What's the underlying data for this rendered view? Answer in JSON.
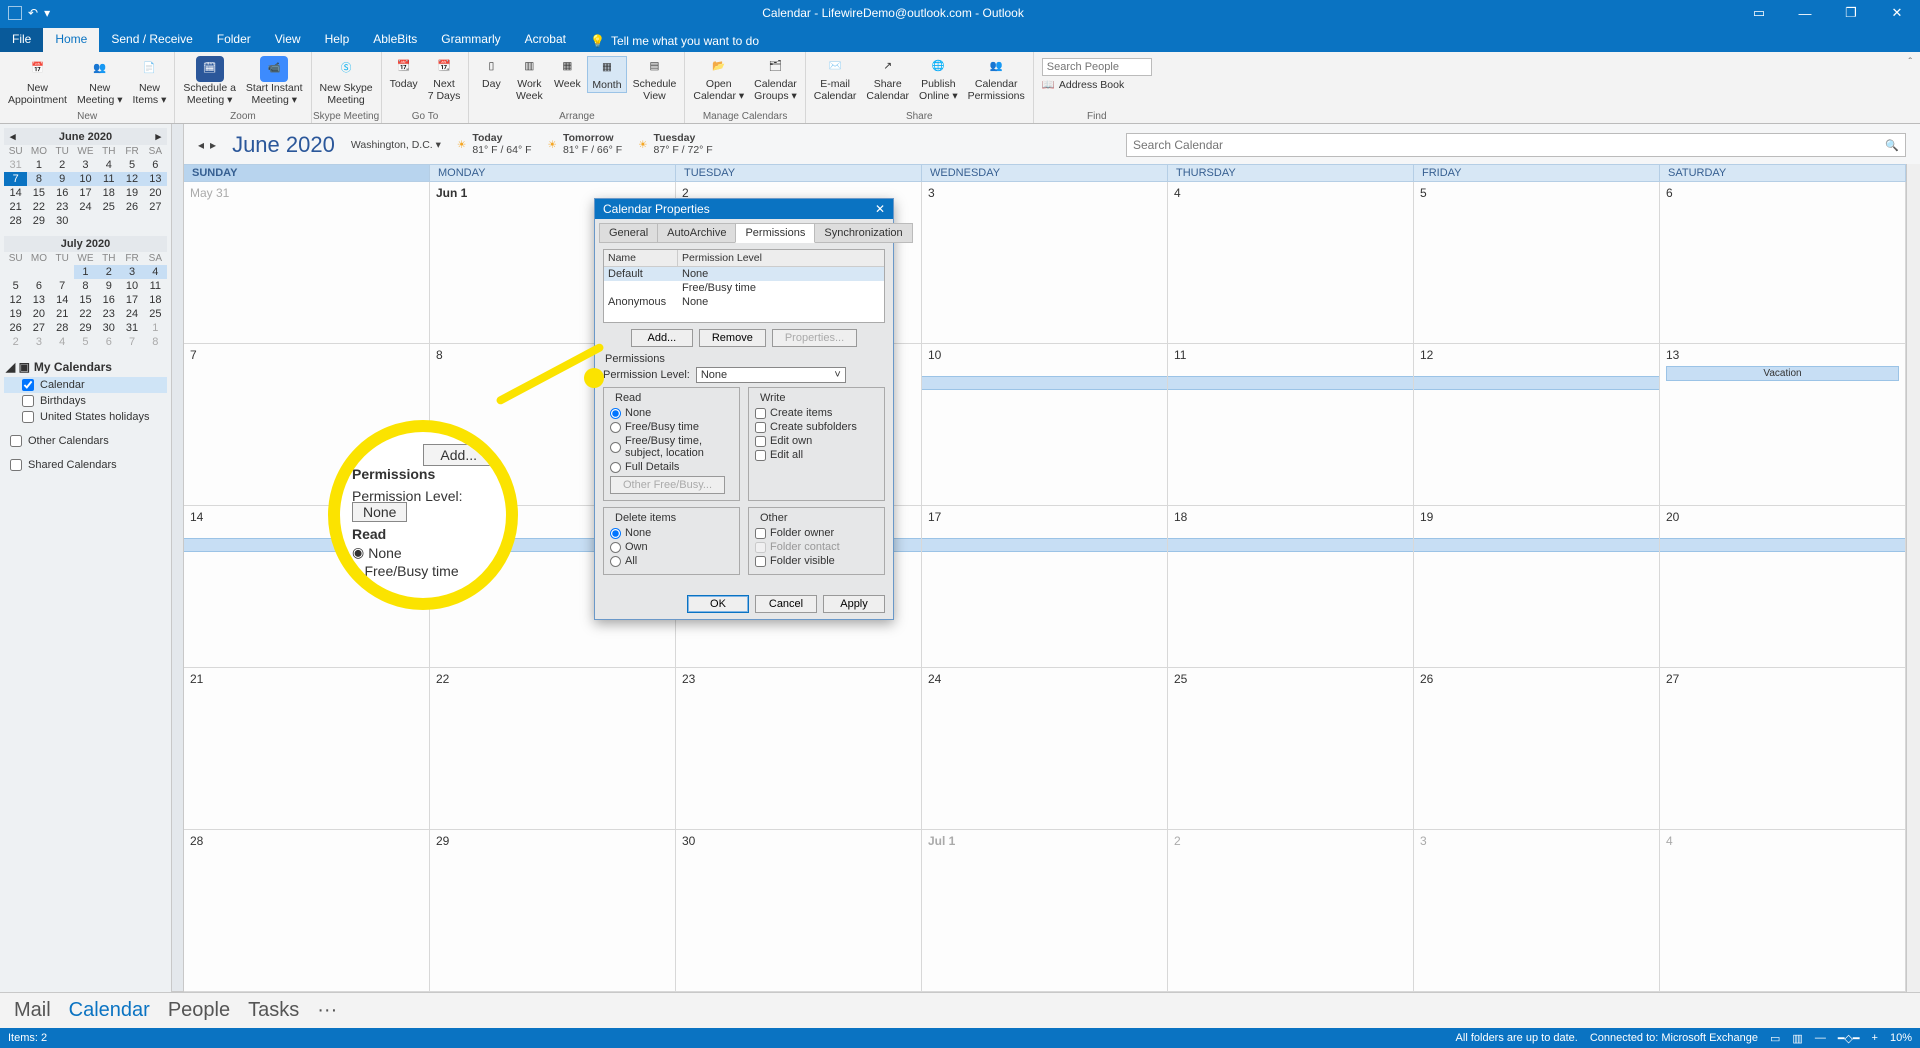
{
  "titlebar": {
    "title": "Calendar - LifewireDemo@outlook.com - Outlook"
  },
  "menu": {
    "file": "File",
    "home": "Home",
    "sendrecv": "Send / Receive",
    "folder": "Folder",
    "view": "View",
    "help": "Help",
    "ablebits": "AbleBits",
    "grammarly": "Grammarly",
    "acrobat": "Acrobat",
    "tellme": "Tell me what you want to do"
  },
  "ribbon": {
    "newapp": "New\nAppointment",
    "newmeet": "New\nMeeting ▾",
    "newitems": "New\nItems ▾",
    "schedmeet": "Schedule a\nMeeting ▾",
    "startinst": "Start Instant\nMeeting ▾",
    "skype": "New Skype\nMeeting",
    "today": "Today",
    "next7": "Next\n7 Days",
    "day": "Day",
    "wweek": "Work\nWeek",
    "week": "Week",
    "month": "Month",
    "schedview": "Schedule\nView",
    "opencal": "Open\nCalendar ▾",
    "calgroups": "Calendar\nGroups ▾",
    "emailcal": "E-mail\nCalendar",
    "sharecal": "Share\nCalendar",
    "pubonline": "Publish\nOnline ▾",
    "calperm": "Calendar\nPermissions",
    "searchppl": "Search People",
    "addrbook": "Address Book",
    "g_new": "New",
    "g_zoom": "Zoom",
    "g_skype": "Skype Meeting",
    "g_goto": "Go To",
    "g_arrange": "Arrange",
    "g_manage": "Manage Calendars",
    "g_share": "Share",
    "g_find": "Find"
  },
  "side": {
    "month1": "June 2020",
    "month2": "July 2020",
    "dow": [
      "SU",
      "MO",
      "TU",
      "WE",
      "TH",
      "FR",
      "SA"
    ],
    "m1": [
      [
        "31",
        "1",
        "2",
        "3",
        "4",
        "5",
        "6"
      ],
      [
        "7",
        "8",
        "9",
        "10",
        "11",
        "12",
        "13"
      ],
      [
        "14",
        "15",
        "16",
        "17",
        "18",
        "19",
        "20"
      ],
      [
        "21",
        "22",
        "23",
        "24",
        "25",
        "26",
        "27"
      ],
      [
        "28",
        "29",
        "30",
        "",
        "",
        "",
        ""
      ]
    ],
    "m2": [
      [
        "",
        "",
        "",
        "1",
        "2",
        "3",
        "4"
      ],
      [
        "5",
        "6",
        "7",
        "8",
        "9",
        "10",
        "11"
      ],
      [
        "12",
        "13",
        "14",
        "15",
        "16",
        "17",
        "18"
      ],
      [
        "19",
        "20",
        "21",
        "22",
        "23",
        "24",
        "25"
      ],
      [
        "26",
        "27",
        "28",
        "29",
        "30",
        "31",
        "1"
      ],
      [
        "2",
        "3",
        "4",
        "5",
        "6",
        "7",
        "8"
      ]
    ],
    "mycal": "My Calendars",
    "calendar": "Calendar",
    "bday": "Birthdays",
    "ushol": "United States holidays",
    "other": "Other Calendars",
    "shared": "Shared Calendars"
  },
  "cal": {
    "title": "June 2020",
    "loc": "Washington, D.C.  ▾",
    "w1": "Today",
    "w1t": "81° F / 64° F",
    "w2": "Tomorrow",
    "w2t": "81° F / 66° F",
    "w3": "Tuesday",
    "w3t": "87° F / 72° F",
    "search": "Search Calendar",
    "days": [
      "SUNDAY",
      "MONDAY",
      "TUESDAY",
      "WEDNESDAY",
      "THURSDAY",
      "FRIDAY",
      "SATURDAY"
    ],
    "r1": [
      "May 31",
      "Jun 1",
      "2",
      "3",
      "4",
      "5",
      "6"
    ],
    "r2": [
      "7",
      "8",
      "9",
      "10",
      "11",
      "12",
      "13"
    ],
    "r3": [
      "14",
      "15",
      "16",
      "17",
      "18",
      "19",
      "20"
    ],
    "r4": [
      "21",
      "22",
      "23",
      "24",
      "25",
      "26",
      "27"
    ],
    "r5": [
      "28",
      "29",
      "30",
      "Jul 1",
      "2",
      "3",
      "4"
    ],
    "vacation": "Vacation"
  },
  "dialog": {
    "title": "Calendar Properties",
    "tabs": {
      "gen": "General",
      "auto": "AutoArchive",
      "perm": "Permissions",
      "sync": "Synchronization"
    },
    "col_name": "Name",
    "col_pl": "Permission Level",
    "rows": [
      {
        "n": "Default",
        "p": "None"
      },
      {
        "n": "",
        "p": "Free/Busy time"
      },
      {
        "n": "Anonymous",
        "p": "None"
      }
    ],
    "add": "Add...",
    "remove": "Remove",
    "props": "Properties...",
    "permissions": "Permissions",
    "permlevel": "Permission Level:",
    "pl_val": "None",
    "read": "Read",
    "write": "Write",
    "r_none": "None",
    "r_fb": "Free/Busy time",
    "r_fbs": "Free/Busy time, subject, location",
    "r_full": "Full Details",
    "r_other": "Other Free/Busy...",
    "w_ci": "Create items",
    "w_cs": "Create subfolders",
    "w_eo": "Edit own",
    "w_ea": "Edit all",
    "del": "Delete items",
    "d_none": "None",
    "d_own": "Own",
    "d_all": "All",
    "other": "Other",
    "o_fo": "Folder owner",
    "o_fc": "Folder contact",
    "o_fv": "Folder visible",
    "ok": "OK",
    "cancel": "Cancel",
    "apply": "Apply"
  },
  "zoom": {
    "add": "Add...",
    "perm": "Permissions",
    "pl": "Permission Level:",
    "none": "None",
    "read": "Read",
    "r_none": "None",
    "r_fb": "Free/Busy time"
  },
  "nav": {
    "mail": "Mail",
    "cal": "Calendar",
    "ppl": "People",
    "tasks": "Tasks"
  },
  "status": {
    "items": "Items: 2",
    "upd": "All folders are up to date.",
    "conn": "Connected to: Microsoft Exchange",
    "zoom": "10%"
  }
}
